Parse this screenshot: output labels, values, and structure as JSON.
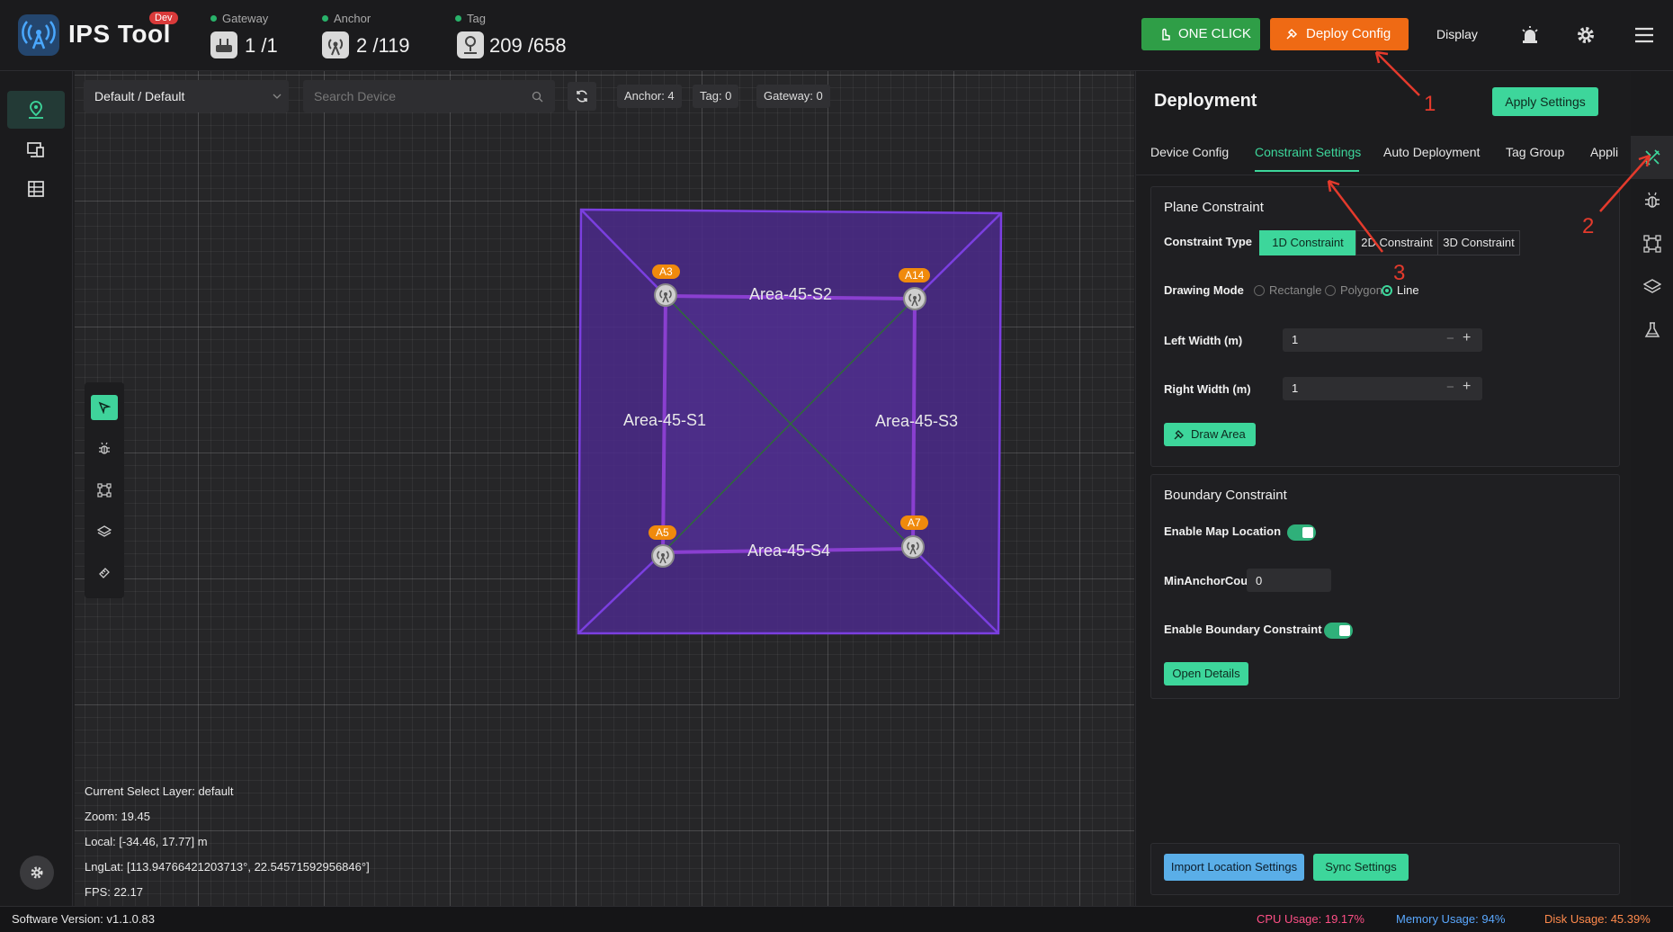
{
  "app": {
    "name": "IPS Tool",
    "badge": "Dev"
  },
  "stats": {
    "gateway": {
      "label": "Gateway",
      "value": "1 /1"
    },
    "anchor": {
      "label": "Anchor",
      "value": "2 /119"
    },
    "tag": {
      "label": "Tag",
      "value": "209 /658"
    }
  },
  "header": {
    "one_click": "ONE CLICK",
    "deploy_config": "Deploy Config",
    "display": "Display"
  },
  "toolbar": {
    "layer_select": "Default / Default",
    "search_placeholder": "Search Device",
    "anchor_chip": "Anchor: 4",
    "tag_chip": "Tag: 0",
    "gateway_chip": "Gateway: 0"
  },
  "map": {
    "areas": [
      "Area-45-S1",
      "Area-45-S2",
      "Area-45-S3",
      "Area-45-S4"
    ],
    "anchors": [
      "A3",
      "A14",
      "A5",
      "A7"
    ],
    "info": {
      "layer": "Current Select Layer:  default",
      "zoom": "Zoom:  19.45",
      "local": "Local:  [-34.46, 17.77] m",
      "lnglat": "LngLat:  [113.94766421203713°, 22.54571592956846°]",
      "fps": "FPS:  22.17"
    }
  },
  "panel": {
    "title": "Deployment",
    "apply_settings": "Apply Settings",
    "tabs": [
      "Device Config",
      "Constraint Settings",
      "Auto Deployment",
      "Tag Group",
      "Appli"
    ],
    "plane": {
      "title": "Plane Constraint",
      "constraint_type_label": "Constraint Type",
      "constraint_types": [
        "1D Constraint",
        "2D Constraint",
        "3D Constraint"
      ],
      "drawing_mode_label": "Drawing Mode",
      "drawing_modes": [
        "Rectangle",
        "Polygon",
        "Line"
      ],
      "left_width_label": "Left Width (m)",
      "left_width_value": "1",
      "right_width_label": "Right Width (m)",
      "right_width_value": "1",
      "draw_area": "Draw Area"
    },
    "boundary": {
      "title": "Boundary Constraint",
      "enable_map_location": "Enable Map Location",
      "min_anchor_count_label": "MinAnchorCount",
      "min_anchor_count_value": "0",
      "enable_boundary": "Enable Boundary Constraint",
      "open_details": "Open Details"
    },
    "import_location": "Import Location Settings",
    "sync_settings": "Sync Settings"
  },
  "annotations": [
    "1",
    "2",
    "3"
  ],
  "status": {
    "version": "Software Version:  v1.1.0.83",
    "cpu": "CPU Usage:  19.17%",
    "memory": "Memory Usage:  94%",
    "disk": "Disk Usage:  45.39%"
  },
  "colors": {
    "accent": "#3dd69b",
    "one_click": "#2f9e47",
    "deploy": "#ef6a14",
    "area_fill": "#4b2a8a",
    "area_stroke": "#7b3fe0",
    "anchor_badge": "#f08a0c",
    "cpu": "#ff4f86",
    "memory": "#5aa8ff",
    "disk": "#ff8a4c"
  }
}
